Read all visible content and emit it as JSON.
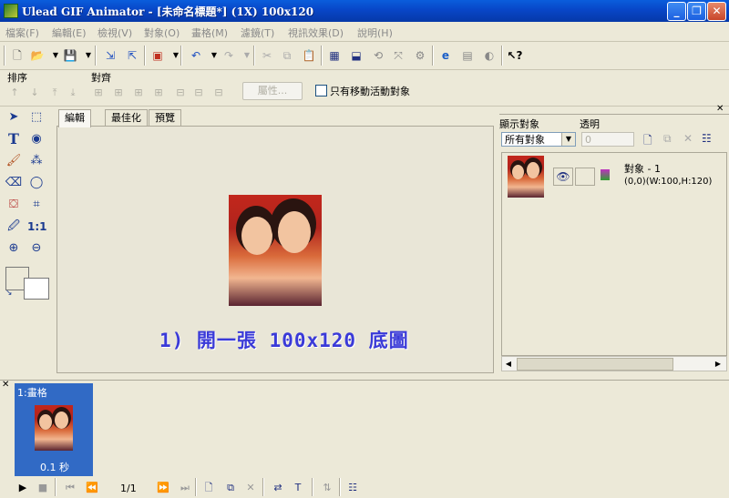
{
  "window": {
    "title": "Ulead GIF Animator - [未命名標題*] (1X) 100x120"
  },
  "menu": [
    "檔案(F)",
    "編輯(E)",
    "檢視(V)",
    "對象(O)",
    "畫格(M)",
    "濾鏡(T)",
    "視訊效果(D)",
    "說明(H)"
  ],
  "propbar": {
    "order_label": "排序",
    "align_label": "對齊",
    "properties_button": "屬性...",
    "only_active_label": "只有移動活動對象"
  },
  "tabs": [
    "編輯",
    "最佳化",
    "預覽"
  ],
  "objects": {
    "display_label": "顯示對象",
    "transparency_label": "透明",
    "display_value": "所有對象",
    "transparency_value": "0",
    "items": [
      {
        "name": "對象 - 1",
        "info": "(0,0)(W:100,H:120)"
      }
    ]
  },
  "overlay_text": "1) 開一張 100x120 底圖",
  "frames": {
    "panel_title": "",
    "items": [
      {
        "label": "1:畫格",
        "delay": "0.1 秒"
      }
    ]
  },
  "playback": {
    "counter": "1/1"
  }
}
